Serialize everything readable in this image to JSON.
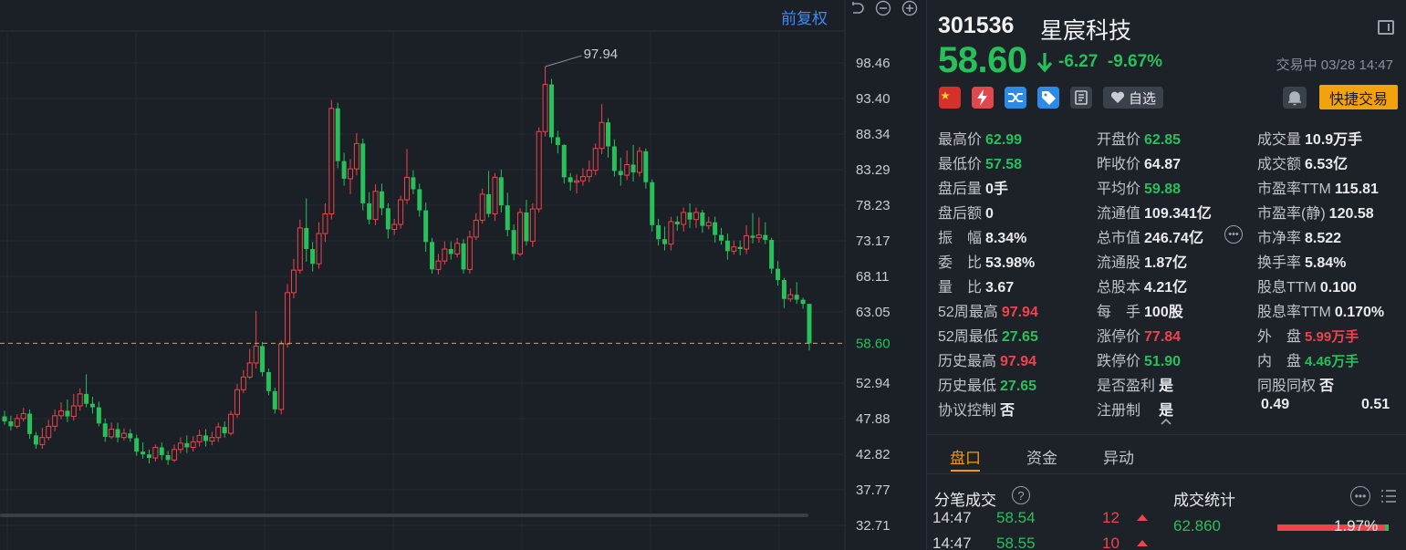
{
  "chart_pane": {
    "restore_label": "前复权",
    "y_ticks": [
      "98.46",
      "93.40",
      "88.34",
      "83.29",
      "78.23",
      "73.17",
      "68.11",
      "63.05",
      "52.94",
      "47.88",
      "42.82",
      "37.77",
      "32.71"
    ],
    "current_price_label": "58.60",
    "high_marker_label": "97.94",
    "colors": {
      "up": "#f0434d",
      "down": "#27c05a",
      "bg": "#1b1f26"
    }
  },
  "chart_data": {
    "type": "candlestick",
    "current_price": 58.6,
    "period_high": 97.94,
    "ylim": [
      32.71,
      100.5
    ],
    "candles": [
      [
        48.2,
        47.5,
        49.0,
        47.0
      ],
      [
        47.5,
        46.8,
        48.3,
        46.2
      ],
      [
        46.8,
        47.9,
        48.5,
        46.5
      ],
      [
        47.9,
        48.6,
        49.4,
        47.5
      ],
      [
        48.6,
        45.7,
        49.2,
        45.0
      ],
      [
        45.5,
        44.2,
        46.0,
        43.6
      ],
      [
        44.2,
        45.2,
        46.6,
        43.6
      ],
      [
        45.2,
        46.8,
        47.7,
        44.8
      ],
      [
        46.8,
        48.3,
        49.2,
        46.1
      ],
      [
        48.3,
        49.0,
        50.2,
        47.8
      ],
      [
        49.0,
        48.2,
        50.6,
        47.4
      ],
      [
        48.2,
        49.7,
        51.4,
        47.6
      ],
      [
        49.7,
        51.4,
        52.2,
        49.0
      ],
      [
        51.4,
        50.0,
        54.2,
        49.5
      ],
      [
        50.0,
        49.5,
        51.0,
        48.6
      ],
      [
        49.5,
        47.2,
        50.3,
        46.8
      ],
      [
        47.2,
        45.3,
        47.9,
        44.6
      ],
      [
        45.3,
        46.4,
        47.3,
        45.0
      ],
      [
        46.4,
        45.2,
        47.3,
        44.5
      ],
      [
        45.2,
        45.8,
        46.5,
        44.8
      ],
      [
        45.8,
        45.1,
        46.4,
        44.6
      ],
      [
        45.1,
        43.2,
        45.6,
        42.6
      ],
      [
        43.2,
        42.8,
        44.5,
        42.2
      ],
      [
        42.8,
        42.3,
        43.5,
        41.5
      ],
      [
        42.3,
        43.8,
        44.2,
        41.8
      ],
      [
        43.8,
        42.7,
        44.5,
        42.0
      ],
      [
        42.7,
        42.0,
        43.3,
        41.3
      ],
      [
        42.0,
        43.5,
        44.2,
        41.7
      ],
      [
        43.5,
        44.4,
        45.2,
        43.0
      ],
      [
        44.4,
        43.8,
        45.5,
        43.0
      ],
      [
        43.8,
        44.6,
        45.4,
        43.2
      ],
      [
        44.6,
        45.5,
        46.3,
        43.9
      ],
      [
        45.5,
        44.7,
        46.4,
        43.9
      ],
      [
        44.7,
        45.2,
        46.0,
        44.1
      ],
      [
        45.2,
        46.7,
        47.3,
        44.6
      ],
      [
        46.7,
        45.8,
        47.5,
        45.2
      ],
      [
        45.8,
        48.5,
        49.0,
        45.5
      ],
      [
        48.5,
        52.0,
        52.8,
        48.0
      ],
      [
        52.0,
        53.8,
        54.8,
        51.5
      ],
      [
        53.8,
        55.8,
        57.8,
        53.5
      ],
      [
        55.8,
        58.2,
        63.2,
        55.0
      ],
      [
        58.2,
        54.5,
        58.8,
        53.9
      ],
      [
        54.5,
        51.8,
        55.0,
        51.2
      ],
      [
        51.8,
        49.2,
        52.3,
        48.6
      ],
      [
        49.2,
        58.5,
        59.0,
        48.5
      ],
      [
        58.5,
        65.8,
        67.0,
        58.0
      ],
      [
        65.8,
        69.0,
        70.6,
        65.0
      ],
      [
        69.0,
        75.0,
        76.2,
        68.5
      ],
      [
        75.0,
        72.0,
        79.2,
        70.2
      ],
      [
        72.0,
        69.9,
        73.0,
        68.8
      ],
      [
        69.9,
        74.2,
        75.8,
        69.2
      ],
      [
        74.2,
        77.0,
        78.5,
        73.0
      ],
      [
        77.0,
        92.0,
        93.2,
        76.2
      ],
      [
        92.0,
        84.5,
        92.8,
        83.5
      ],
      [
        84.5,
        82.0,
        85.7,
        81.0
      ],
      [
        82.0,
        83.4,
        84.8,
        79.8
      ],
      [
        83.4,
        87.0,
        88.5,
        82.5
      ],
      [
        87.0,
        78.5,
        87.7,
        77.5
      ],
      [
        78.5,
        76.2,
        80.1,
        75.5
      ],
      [
        76.2,
        80.2,
        81.2,
        75.4
      ],
      [
        80.2,
        77.8,
        81.3,
        76.8
      ],
      [
        77.8,
        74.8,
        78.5,
        73.5
      ],
      [
        74.8,
        75.5,
        76.3,
        74.0
      ],
      [
        75.5,
        79.0,
        79.6,
        74.9
      ],
      [
        79.0,
        82.2,
        86.2,
        78.4
      ],
      [
        82.2,
        80.5,
        83.2,
        79.8
      ],
      [
        80.5,
        77.5,
        81.3,
        76.6
      ],
      [
        77.5,
        73.0,
        78.6,
        71.6
      ],
      [
        73.0,
        69.1,
        73.6,
        68.5
      ],
      [
        69.1,
        70.3,
        71.3,
        68.4
      ],
      [
        70.3,
        72.0,
        73.1,
        69.8
      ],
      [
        72.0,
        71.3,
        73.1,
        70.5
      ],
      [
        71.3,
        72.8,
        73.6,
        70.8
      ],
      [
        72.8,
        69.1,
        73.4,
        68.5
      ],
      [
        69.1,
        73.7,
        74.6,
        68.5
      ],
      [
        73.7,
        76.1,
        77.1,
        73.3
      ],
      [
        76.1,
        79.8,
        80.6,
        75.6
      ],
      [
        79.8,
        77.0,
        83.1,
        76.5
      ],
      [
        77.0,
        82.2,
        82.8,
        76.0
      ],
      [
        82.2,
        78.2,
        83.3,
        77.2
      ],
      [
        78.2,
        74.7,
        80.0,
        73.8
      ],
      [
        74.7,
        71.3,
        75.5,
        70.4
      ],
      [
        71.3,
        77.2,
        77.8,
        71.0
      ],
      [
        77.2,
        73.1,
        79.0,
        72.5
      ],
      [
        73.1,
        77.7,
        78.5,
        72.3
      ],
      [
        77.7,
        88.7,
        89.3,
        77.2
      ],
      [
        88.7,
        95.4,
        97.94,
        88.0
      ],
      [
        95.4,
        87.9,
        96.2,
        87.0
      ],
      [
        87.9,
        86.8,
        88.8,
        85.6
      ],
      [
        86.8,
        82.2,
        86.9,
        81.3
      ],
      [
        82.2,
        81.5,
        82.8,
        80.3
      ],
      [
        81.5,
        81.7,
        82.6,
        79.9
      ],
      [
        81.7,
        82.3,
        83.5,
        81.0
      ],
      [
        82.3,
        83.2,
        84.6,
        81.5
      ],
      [
        83.2,
        86.3,
        87.0,
        82.5
      ],
      [
        86.3,
        90.0,
        92.6,
        85.5
      ],
      [
        90.0,
        86.6,
        90.6,
        85.0
      ],
      [
        86.6,
        83.1,
        87.6,
        82.3
      ],
      [
        83.1,
        82.5,
        85.0,
        81.0
      ],
      [
        82.5,
        84.0,
        86.0,
        81.8
      ],
      [
        84.0,
        82.9,
        86.8,
        81.6
      ],
      [
        82.9,
        85.9,
        86.5,
        82.3
      ],
      [
        85.9,
        81.5,
        86.3,
        80.6
      ],
      [
        81.5,
        75.4,
        81.9,
        74.5
      ],
      [
        75.4,
        73.4,
        76.3,
        72.5
      ],
      [
        73.4,
        72.7,
        75.2,
        71.8
      ],
      [
        72.7,
        75.9,
        76.6,
        71.8
      ],
      [
        75.9,
        75.5,
        76.7,
        74.6
      ],
      [
        75.5,
        77.2,
        77.9,
        74.5
      ],
      [
        77.2,
        76.2,
        78.5,
        75.0
      ],
      [
        76.2,
        77.2,
        77.9,
        75.0
      ],
      [
        77.2,
        75.3,
        77.6,
        74.3
      ],
      [
        75.3,
        75.8,
        76.6,
        74.8
      ],
      [
        75.8,
        74.0,
        76.6,
        72.9
      ],
      [
        74.0,
        73.2,
        75.0,
        72.6
      ],
      [
        73.2,
        71.7,
        74.2,
        70.5
      ],
      [
        71.7,
        72.3,
        73.2,
        71.2
      ],
      [
        72.3,
        72.0,
        73.2,
        71.1
      ],
      [
        72.0,
        73.9,
        75.4,
        71.3
      ],
      [
        73.9,
        73.6,
        77.1,
        72.8
      ],
      [
        73.6,
        74.0,
        76.5,
        72.9
      ],
      [
        74.0,
        73.3,
        75.8,
        72.7
      ],
      [
        73.3,
        69.2,
        73.6,
        68.5
      ],
      [
        69.2,
        67.6,
        70.3,
        66.8
      ],
      [
        67.6,
        64.9,
        67.9,
        63.6
      ],
      [
        64.9,
        65.5,
        66.4,
        64.5
      ],
      [
        65.5,
        64.8,
        67.3,
        64.2
      ],
      [
        64.8,
        64.2,
        65.1,
        63.5
      ],
      [
        64.2,
        58.6,
        64.2,
        57.58
      ]
    ]
  },
  "header": {
    "code": "301536",
    "name": "星宸科技",
    "price": "58.60",
    "change": "-6.27",
    "change_pct": "-9.67%",
    "status": "交易中 03/28 14:47"
  },
  "actions": {
    "fav_label": "自选",
    "trade_label": "快捷交易"
  },
  "stats": {
    "col1": [
      {
        "label": "最高价",
        "value": "62.99",
        "color": "green"
      },
      {
        "label": "最低价",
        "value": "57.58",
        "color": "green"
      },
      {
        "label": "盘后量",
        "value": "0手",
        "color": ""
      },
      {
        "label": "盘后额",
        "value": "0",
        "color": ""
      },
      {
        "label": "振　幅",
        "value": "8.34%",
        "color": ""
      },
      {
        "label": "委　比",
        "value": "53.98%",
        "color": ""
      },
      {
        "label": "量　比",
        "value": "3.67",
        "color": ""
      },
      {
        "label": "52周最高",
        "value": "97.94",
        "color": "red"
      },
      {
        "label": "52周最低",
        "value": "27.65",
        "color": "green"
      },
      {
        "label": "历史最高",
        "value": "97.94",
        "color": "red"
      },
      {
        "label": "历史最低",
        "value": "27.65",
        "color": "green"
      },
      {
        "label": "协议控制",
        "value": "否",
        "color": ""
      }
    ],
    "col2": [
      {
        "label": "开盘价",
        "value": "62.85",
        "color": "green"
      },
      {
        "label": "昨收价",
        "value": "64.87",
        "color": ""
      },
      {
        "label": "平均价",
        "value": "59.88",
        "color": "green"
      },
      {
        "label": "流通值",
        "value": "109.341亿",
        "color": ""
      },
      {
        "label": "总市值",
        "value": "246.74亿",
        "color": ""
      },
      {
        "label": "流通股",
        "value": "1.87亿",
        "color": ""
      },
      {
        "label": "总股本",
        "value": "4.21亿",
        "color": ""
      },
      {
        "label": "每　手",
        "value": "100股",
        "color": ""
      },
      {
        "label": "涨停价",
        "value": "77.84",
        "color": "red"
      },
      {
        "label": "跌停价",
        "value": "51.90",
        "color": "green"
      },
      {
        "label": "是否盈利",
        "value": "是",
        "color": ""
      },
      {
        "label": "注册制",
        "value": "　是",
        "color": ""
      }
    ],
    "col3": [
      {
        "label": "成交量",
        "value": "10.9万手",
        "color": ""
      },
      {
        "label": "成交额",
        "value": "6.53亿",
        "color": ""
      },
      {
        "label": "市盈率TTM",
        "value": "115.81",
        "color": ""
      },
      {
        "label": "市盈率(静)",
        "value": "120.58",
        "color": ""
      },
      {
        "label": "市净率",
        "value": "8.522",
        "color": ""
      },
      {
        "label": "换手率",
        "value": "5.84%",
        "color": ""
      },
      {
        "label": "股息TTM",
        "value": "0.100",
        "color": ""
      },
      {
        "label": "股息率TTM",
        "value": "0.170%",
        "color": ""
      },
      {
        "label": "外　盘",
        "value": "5.99万手",
        "color": "ur"
      },
      {
        "label": "内　盘",
        "value": "4.46万手",
        "color": "ug"
      },
      {
        "label": "同股同权",
        "value": "否",
        "color": ""
      }
    ],
    "ratio_left": "0.49",
    "ratio_right": "0.51"
  },
  "tabs": [
    "盘口",
    "资金",
    "异动"
  ],
  "ticks_section": {
    "title": "分笔成交",
    "rows": [
      {
        "time": "14:47",
        "price": "58.54",
        "vol": "12"
      },
      {
        "time": "14:47",
        "price": "58.55",
        "vol": "10"
      }
    ]
  },
  "volume_stats": {
    "title": "成交统计",
    "row": {
      "price": "62.860",
      "pct": "1.97%"
    }
  }
}
